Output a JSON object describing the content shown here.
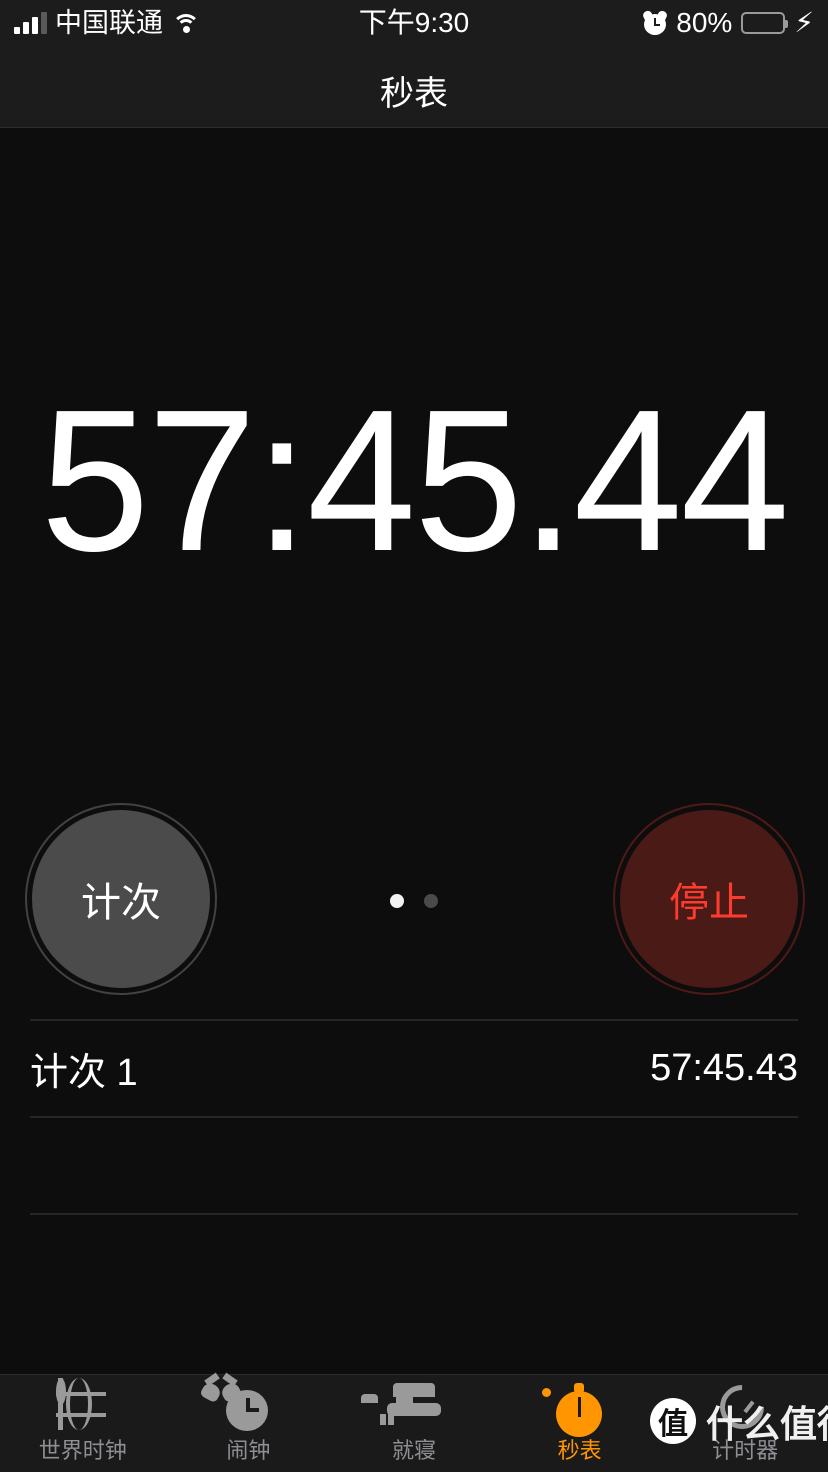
{
  "status_bar": {
    "carrier": "中国联通",
    "signal_icon": "signal-bars-icon",
    "wifi_icon": "wifi-icon",
    "time": "下午9:30",
    "alarm_icon": "alarm-clock-icon",
    "battery_percent": "80%",
    "battery_level": 80,
    "battery_color": "#4cd964",
    "charging_icon": "lightning-bolt-icon"
  },
  "nav": {
    "title": "秒表"
  },
  "stopwatch": {
    "display": "57:45.44",
    "lap_button_label": "计次",
    "stop_button_label": "停止",
    "stop_color": "#ff3b30",
    "page_dots": {
      "count": 2,
      "active_index": 0
    }
  },
  "laps": {
    "rows": [
      {
        "label": "计次 1",
        "time": "57:45.43"
      },
      {
        "label": "",
        "time": ""
      },
      {
        "label": "",
        "time": ""
      }
    ]
  },
  "tab_bar": {
    "active_index": 3,
    "active_color": "#ff9500",
    "inactive_color": "#8e8e93",
    "items": [
      {
        "label": "世界时钟",
        "icon": "globe-icon"
      },
      {
        "label": "闹钟",
        "icon": "alarm-clock-icon"
      },
      {
        "label": "就寝",
        "icon": "bed-icon"
      },
      {
        "label": "秒表",
        "icon": "stopwatch-icon"
      },
      {
        "label": "计时器",
        "icon": "timer-icon"
      }
    ]
  },
  "watermark": {
    "badge": "值",
    "text": "什么值得买"
  }
}
